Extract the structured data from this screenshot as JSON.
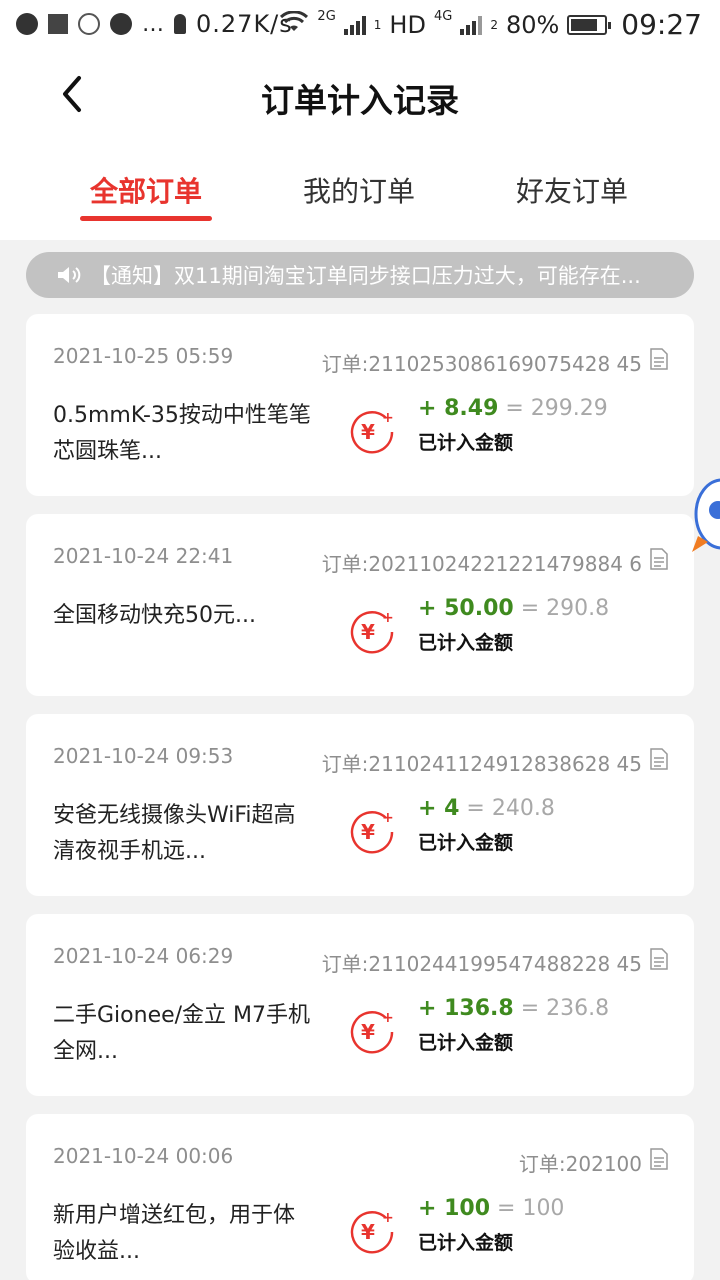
{
  "status_bar": {
    "speed": "0.27K/s",
    "net_2g": "2G",
    "hd": "HD",
    "net_4g": "4G",
    "sim1": "1",
    "sim2": "2",
    "battery_text": "80%",
    "battery_level": 0.8,
    "time": "09:27"
  },
  "header": {
    "title": "订单计入记录",
    "back_icon": "chevron-left-icon"
  },
  "tabs": [
    {
      "label": "全部订单",
      "active": true
    },
    {
      "label": "我的订单",
      "active": false
    },
    {
      "label": "好友订单",
      "active": false
    }
  ],
  "notice": {
    "icon": "speaker-icon",
    "text": "【通知】双11期间淘宝订单同步接口压力过大，可能存在..."
  },
  "orders": [
    {
      "date": "2021-10-25 05:59",
      "order_id": "订单:2110253086169075428 45",
      "name": "0.5mmK-35按动中性笔笔芯圆珠笔...",
      "add": "+ 8.49",
      "total": "= 299.29",
      "label": "已计入金额"
    },
    {
      "date": "2021-10-24 22:41",
      "order_id": "订单:20211024221221479884 6",
      "name": "全国移动快充50元...",
      "add": "+ 50.00",
      "total": "= 290.8",
      "label": "已计入金额"
    },
    {
      "date": "2021-10-24 09:53",
      "order_id": "订单:2110241124912838628 45",
      "name": "安爸无线摄像头WiFi超高清夜视手机远...",
      "add": "+ 4",
      "total": "= 240.8",
      "label": "已计入金额"
    },
    {
      "date": "2021-10-24 06:29",
      "order_id": "订单:2110244199547488228 45",
      "name": "二手Gionee/金立 M7手机 全网...",
      "add": "+ 136.8",
      "total": "= 236.8",
      "label": "已计入金额"
    },
    {
      "date": "2021-10-24 00:06",
      "order_id": "订单:202100",
      "name": "新用户增送红包，用于体验收益...",
      "add": "+ 100",
      "total": "= 100",
      "label": "已计入金额"
    }
  ],
  "colors": {
    "accent_red": "#e8342e",
    "amount_green": "#3f8a1f",
    "muted_gray": "#8e8e8e",
    "notice_bg": "#c2c2c2"
  },
  "icons": {
    "order_doc": "document-icon",
    "yuan": "yuan-plus-icon"
  }
}
